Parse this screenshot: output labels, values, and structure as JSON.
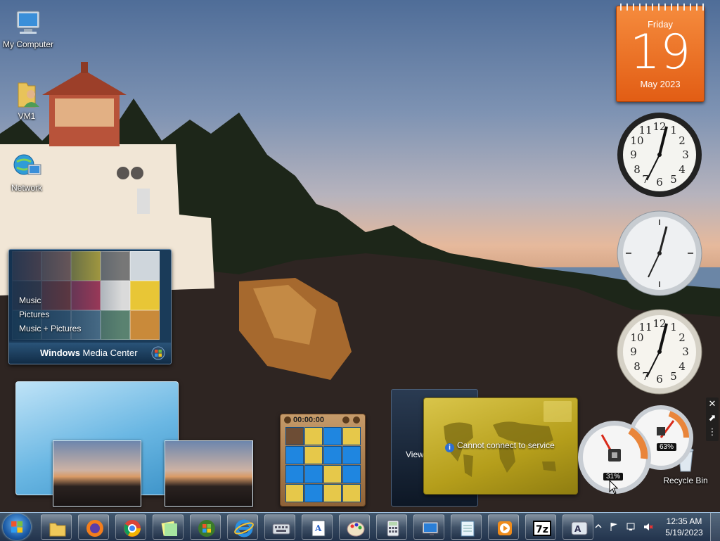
{
  "desktop": {
    "icons": [
      {
        "label": "My Computer",
        "icon": "computer-icon"
      },
      {
        "label": "VM1",
        "icon": "user-folder-icon"
      },
      {
        "label": "Network",
        "icon": "network-icon"
      },
      {
        "label": "Recycle Bin",
        "icon": "recycle-bin-icon"
      }
    ]
  },
  "gadgets": {
    "calendar": {
      "weekday": "Friday",
      "day": "19",
      "month_year": "May 2023"
    },
    "media_center": {
      "menu": [
        "Music",
        "Pictures",
        "Music + Pictures"
      ],
      "brand_bold": "Windows",
      "brand_rest": " Media Center"
    },
    "feed_viewer": {
      "label": "View"
    },
    "currency": {
      "message": "Cannot connect to service"
    },
    "puzzle": {
      "timer": "00:00:00"
    },
    "cpu_meter": {
      "cpu": "31%",
      "memory": "63%"
    }
  },
  "taskbar": {
    "pinned": [
      "explorer-icon",
      "firefox-icon",
      "chrome-icon",
      "sticky-notes-icon",
      "windows-logo-icon",
      "internet-explorer-icon",
      "keyboard-icon",
      "wordpad-icon",
      "paint-icon",
      "calculator-icon",
      "remote-desktop-icon",
      "notepad-icon",
      "media-player-icon",
      "7zip-icon",
      "character-map-icon"
    ],
    "time": "12:35 AM",
    "date": "5/19/2023"
  },
  "colors": {
    "calendar": "#e8691f",
    "taskbar": "#3a5a80",
    "currency": "#c4ad2e"
  }
}
